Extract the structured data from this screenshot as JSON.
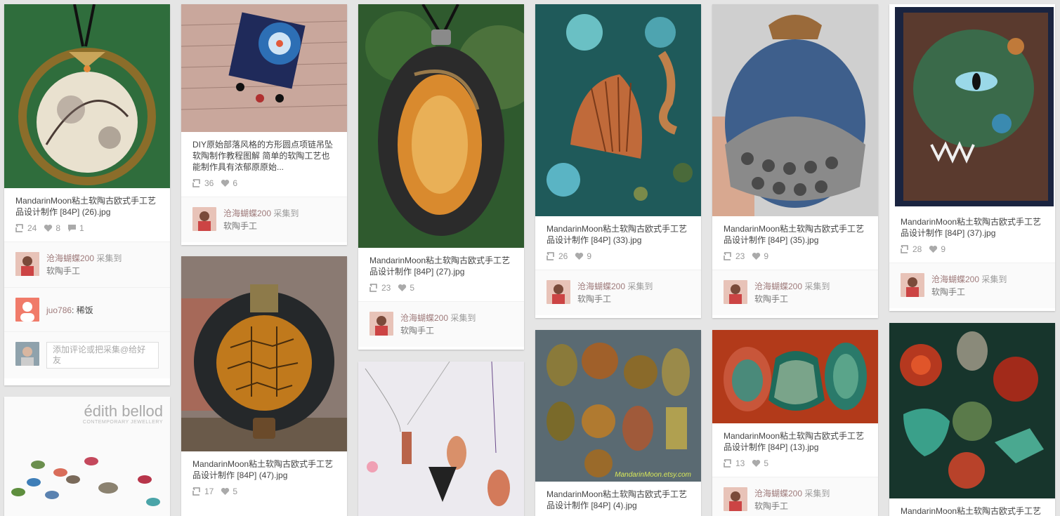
{
  "pins": {
    "p1": {
      "description": "MandarinMoon粘土软陶古欧式手工艺品设计制作 [84P] (26).jpg",
      "repins": "24",
      "likes": "8",
      "comments": "1",
      "via_user": "沧海蝴蝶200",
      "via_action": "采集到",
      "board": "软陶手工",
      "comment_user": "juo786",
      "comment_text": ": 稀饭",
      "comment_placeholder": "添加评论或把采集@给好友"
    },
    "p2": {
      "description": "DIY原始部落风格的方形圆点项链吊坠软陶制作教程图解 简单的软陶工艺也能制作具有浓郁原原始...",
      "repins": "36",
      "likes": "6",
      "via_user": "沧海蝴蝶200",
      "via_action": "采集到",
      "board": "软陶手工"
    },
    "p3": {
      "description": "MandarinMoon粘土软陶古欧式手工艺品设计制作 [84P] (27).jpg",
      "repins": "23",
      "likes": "5",
      "via_user": "沧海蝴蝶200",
      "via_action": "采集到",
      "board": "软陶手工"
    },
    "p4": {
      "description": "MandarinMoon粘土软陶古欧式手工艺品设计制作 [84P] (33).jpg",
      "repins": "26",
      "likes": "9",
      "via_user": "沧海蝴蝶200",
      "via_action": "采集到",
      "board": "软陶手工"
    },
    "p5": {
      "description": "MandarinMoon粘土软陶古欧式手工艺品设计制作 [84P] (35).jpg",
      "repins": "23",
      "likes": "9",
      "via_user": "沧海蝴蝶200",
      "via_action": "采集到",
      "board": "软陶手工"
    },
    "p6": {
      "description": "MandarinMoon粘土软陶古欧式手工艺品设计制作 [84P] (37).jpg",
      "repins": "28",
      "likes": "9",
      "via_user": "沧海蝴蝶200",
      "via_action": "采集到",
      "board": "软陶手工"
    },
    "p7": {
      "brand": "édith bellod",
      "brand_sub": "CONTEMPORARY JEWELLERY"
    },
    "p8": {
      "description": "MandarinMoon粘土软陶古欧式手工艺品设计制作 [84P] (47).jpg",
      "repins": "17",
      "likes": "5"
    },
    "p10": {
      "watermark": "MandarinMoon.etsy.com",
      "description": "MandarinMoon粘土软陶古欧式手工艺品设计制作 [84P] (4).jpg"
    },
    "p11": {
      "description": "MandarinMoon粘土软陶古欧式手工艺品设计制作 [84P] (13).jpg",
      "repins": "13",
      "likes": "5",
      "via_user": "沧海蝴蝶200",
      "via_action": "采集到",
      "board": "软陶手工"
    },
    "p12": {
      "description": "MandarinMoon粘土软陶古欧式手工艺品设计制作"
    }
  },
  "icons": {
    "repin": "repin-icon",
    "like": "heart-icon",
    "comment": "comment-icon"
  },
  "colors": {
    "background": "#e5e5e5",
    "card": "#ffffff",
    "username": "#9e7a7a",
    "muted": "#999999"
  }
}
